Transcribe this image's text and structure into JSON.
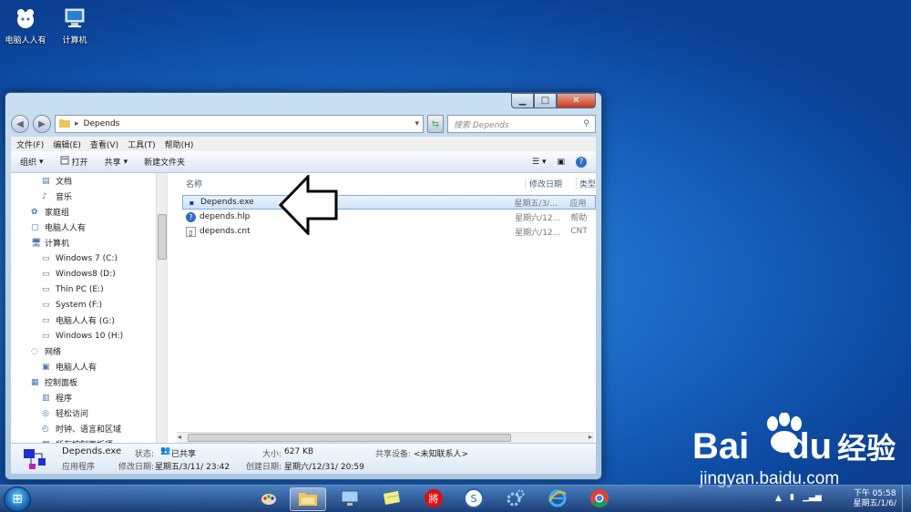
{
  "desktop": {
    "icons": [
      {
        "label": "电脑人人有",
        "icon": "user-folder-icon"
      },
      {
        "label": "计算机",
        "icon": "computer-icon"
      }
    ]
  },
  "window": {
    "address": {
      "path": "Depends",
      "separator": "▸"
    },
    "search_placeholder": "搜索 Depends",
    "menu": [
      "文件(F)",
      "编辑(E)",
      "查看(V)",
      "工具(T)",
      "帮助(H)"
    ],
    "commands": {
      "organize": "组织",
      "open": "打开",
      "share": "共享",
      "new_folder": "新建文件夹"
    },
    "nav": [
      {
        "label": "文档",
        "indent": 2,
        "icon": "document-icon"
      },
      {
        "label": "音乐",
        "indent": 2,
        "icon": "music-icon"
      },
      {
        "label": "家庭组",
        "indent": 1,
        "icon": "homegroup-icon"
      },
      {
        "label": "电脑人人有",
        "indent": 1,
        "icon": "user-folder-icon"
      },
      {
        "label": "计算机",
        "indent": 1,
        "icon": "computer-icon"
      },
      {
        "label": "Windows 7  (C:)",
        "indent": 2,
        "icon": "system-drive-icon"
      },
      {
        "label": "Windows8 (D:)",
        "indent": 2,
        "icon": "drive-icon"
      },
      {
        "label": "Thin PC (E:)",
        "indent": 2,
        "icon": "drive-icon"
      },
      {
        "label": "System (F:)",
        "indent": 2,
        "icon": "drive-icon"
      },
      {
        "label": "电脑人人有 (G:)",
        "indent": 2,
        "icon": "drive-icon"
      },
      {
        "label": "Windows 10 (H:)",
        "indent": 2,
        "icon": "drive-icon"
      },
      {
        "label": "网络",
        "indent": 1,
        "icon": "network-icon"
      },
      {
        "label": "电脑人人有",
        "indent": 2,
        "icon": "monitor-icon"
      },
      {
        "label": "控制面板",
        "indent": 1,
        "icon": "control-panel-icon"
      },
      {
        "label": "程序",
        "indent": 2,
        "icon": "programs-icon"
      },
      {
        "label": "轻松访问",
        "indent": 2,
        "icon": "ease-access-icon"
      },
      {
        "label": "时钟、语言和区域",
        "indent": 2,
        "icon": "clock-language-icon"
      },
      {
        "label": "所有控制面板项",
        "indent": 2,
        "icon": "control-panel-icon"
      }
    ],
    "columns": {
      "name": "名称",
      "modified": "修改日期",
      "type": "类型"
    },
    "files": [
      {
        "name": "Depends.exe",
        "modified": "星期五/3/...",
        "type": "应用",
        "icon": "exe-icon",
        "selected": true
      },
      {
        "name": "depends.hlp",
        "modified": "星期六/12...",
        "type": "帮助",
        "icon": "help-file-icon",
        "selected": false
      },
      {
        "name": "depends.cnt",
        "modified": "星期六/12...",
        "type": "CNT",
        "icon": "file-icon",
        "selected": false
      }
    ],
    "details": {
      "file_name": "Depends.exe",
      "file_type": "应用程序",
      "status_label": "状态:",
      "status_value": "已共享",
      "modified_label": "修改日期:",
      "modified_value": "星期五/3/11/ 23:42",
      "size_label": "大小:",
      "size_value": "627 KB",
      "created_label": "创建日期:",
      "created_value": "星期六/12/31/ 20:59",
      "share_label": "共享设备:",
      "share_value": "<未知联系人>"
    }
  },
  "taskbar": {
    "apps": [
      "paint-icon",
      "explorer-icon",
      "remote-desktop-icon",
      "sticky-notes-icon",
      "chinese-chess-icon",
      "sogou-icon",
      "gear-icon",
      "ie-icon",
      "chrome-icon"
    ],
    "clock": {
      "time": "下午 05:58",
      "date": "星期五/1/6/"
    }
  },
  "watermark": {
    "brand": "Bai",
    "brand2": "du",
    "brand_cn": "经验",
    "url": "jingyan.baidu.com"
  }
}
